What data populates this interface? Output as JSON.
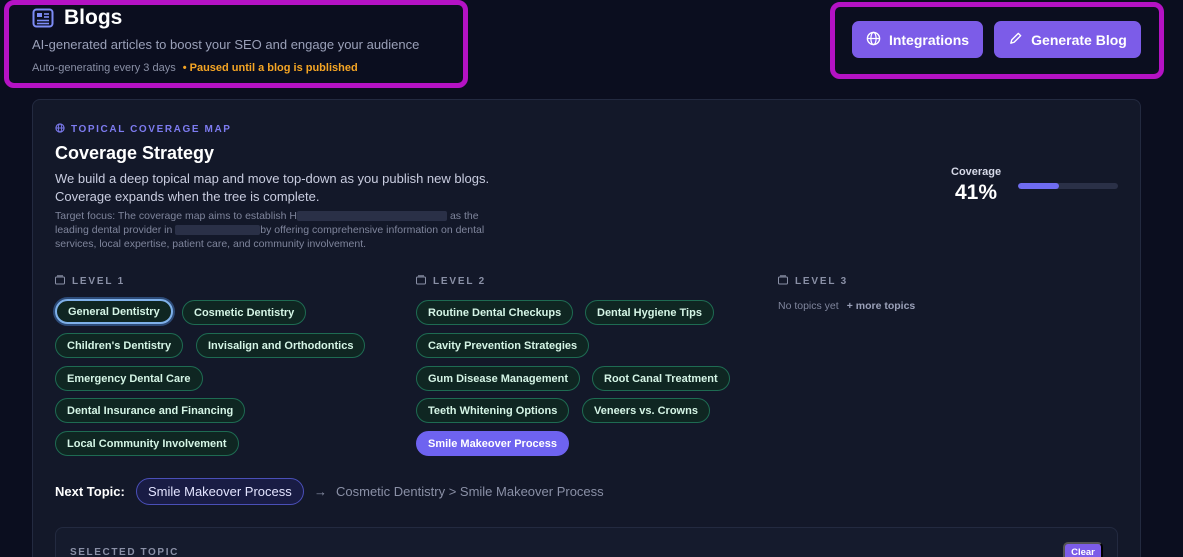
{
  "header": {
    "title": "Blogs",
    "subtitle": "AI-generated articles to boost your SEO and engage your audience",
    "status_auto": "Auto-generating every 3 days",
    "status_paused": "• Paused until a blog is published",
    "integrations_label": "Integrations",
    "generate_label": "Generate Blog"
  },
  "coverage_map": {
    "eyebrow": "TOPICAL COVERAGE MAP",
    "title": "Coverage Strategy",
    "description": "We build a deep topical map and move top-down as you publish new blogs. Coverage expands when the tree is complete.",
    "focus_part1": "Target focus: The coverage map aims to establish H",
    "focus_part2": "as the leading dental provider in",
    "focus_part3": "by offering comprehensive information on dental services, local expertise, patient care, and community involvement.",
    "coverage_label": "Coverage",
    "coverage_value": "41%",
    "coverage_fraction": 0.41
  },
  "levels": {
    "level1": {
      "label": "LEVEL 1",
      "topics": [
        "General Dentistry",
        "Cosmetic Dentistry",
        "Children's Dentistry",
        "Invisalign and Orthodontics",
        "Emergency Dental Care",
        "Dental Insurance and Financing",
        "Local Community Involvement"
      ]
    },
    "level2": {
      "label": "LEVEL 2",
      "topics": [
        "Routine Dental Checkups",
        "Dental Hygiene Tips",
        "Cavity Prevention Strategies",
        "Gum Disease Management",
        "Root Canal Treatment",
        "Teeth Whitening Options",
        "Veneers vs. Crowns",
        "Smile Makeover Process"
      ]
    },
    "level3": {
      "label": "LEVEL 3",
      "empty_text": "No topics yet",
      "more_text": "+ more topics"
    }
  },
  "next_topic": {
    "label": "Next Topic:",
    "topic": "Smile Makeover Process",
    "arrow": "→",
    "path": "Cosmetic Dentistry > Smile Makeover Process"
  },
  "selected_topic": {
    "label": "SELECTED TOPIC",
    "clear_label": "Clear"
  },
  "colors": {
    "accent": "#7c5ce8",
    "paused": "#f5a524",
    "chip_border": "#1e6b52",
    "active_chip": "#6e63f0"
  }
}
